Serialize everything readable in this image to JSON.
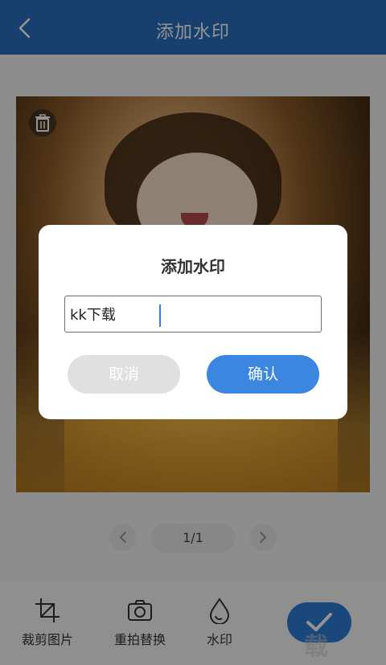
{
  "header": {
    "title": "添加水印",
    "back_icon": "chevron-left-icon"
  },
  "photo": {
    "delete_icon": "trash-icon"
  },
  "pager": {
    "count": "1/1",
    "prev_icon": "chevron-left-icon",
    "next_icon": "chevron-right-icon"
  },
  "toolbar": {
    "items": [
      {
        "label": "裁剪图片",
        "icon": "crop-icon"
      },
      {
        "label": "重拍替换",
        "icon": "camera-icon"
      },
      {
        "label": "水印",
        "icon": "droplet-icon"
      }
    ],
    "confirm_icon": "check-icon"
  },
  "watermark_text": "载",
  "dialog": {
    "title": "添加水印",
    "input_value": "kk下载",
    "cancel_label": "取消",
    "ok_label": "确认"
  },
  "colors": {
    "header": "#2a6fbf",
    "accent": "#3a86e0",
    "cancel": "#e0e0e0"
  }
}
